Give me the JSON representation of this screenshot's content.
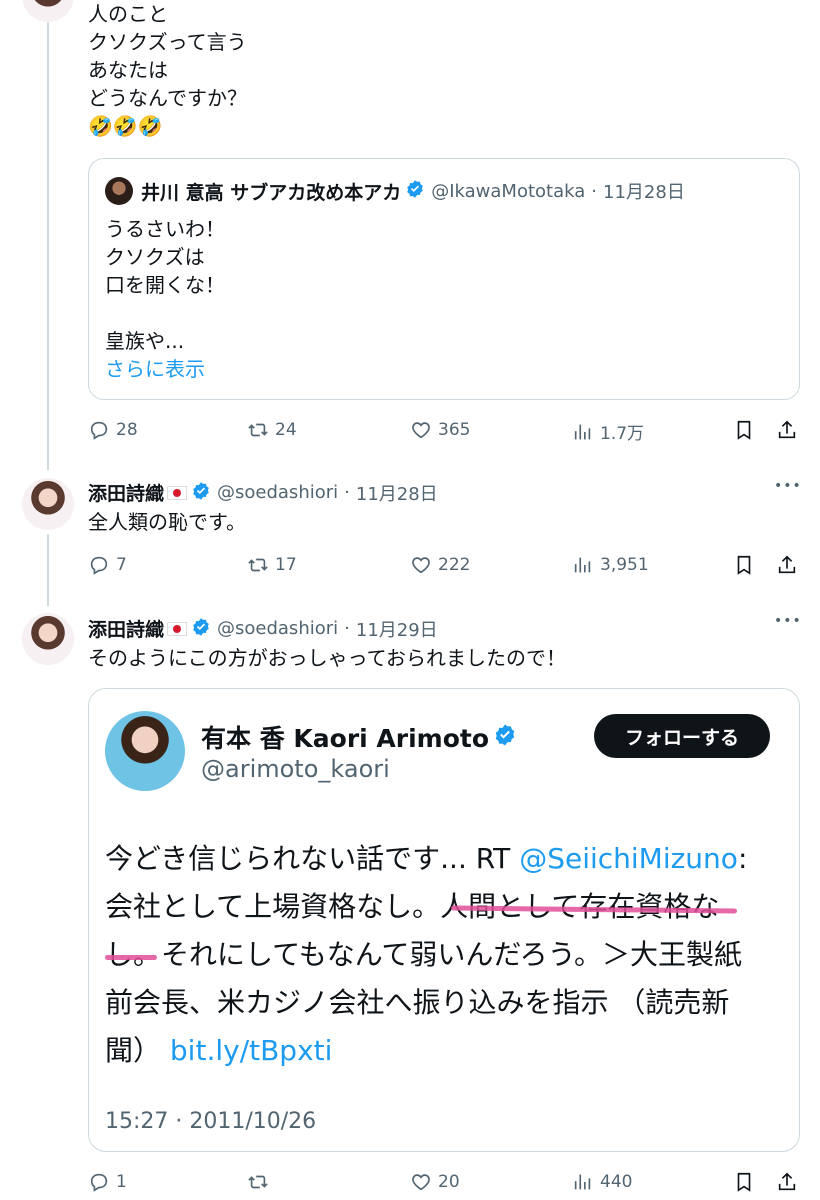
{
  "tweet1": {
    "lines": [
      "人のこと",
      "クソクズって言う",
      "あなたは",
      "どうなんですか？"
    ],
    "emoji": "🤣🤣🤣",
    "quote": {
      "name": "井川 意高 サブアカ改め本アカ",
      "handle": "@IkawaMototaka",
      "sep": "·",
      "date": "11月28日",
      "lines": [
        "うるさいわ！",
        "クソクズは",
        "口を開くな！",
        "",
        "皇族や..."
      ],
      "show_more": "さらに表示"
    },
    "actions": {
      "replies": "28",
      "reposts": "24",
      "likes": "365",
      "views": "1.7万"
    }
  },
  "tweet2": {
    "name": "添田詩織",
    "handle": "@soedashiori",
    "sep": "·",
    "date": "11月28日",
    "text": "全人類の恥です。",
    "actions": {
      "replies": "7",
      "reposts": "17",
      "likes": "222",
      "views": "3,951"
    },
    "more": "•••"
  },
  "tweet3": {
    "name": "添田詩織",
    "handle": "@soedashiori",
    "sep": "·",
    "date": "11月29日",
    "text": "そのようにこの方がおっしゃっておられましたので！",
    "more": "•••",
    "embed": {
      "name": "有本 香 Kaori Arimoto",
      "handle": "@arimoto_kaori",
      "follow": "フォローする",
      "line1_a": "今どき信じられない話です... RT ",
      "line1_mention": "@SeiichiMizuno",
      "line1_b": ":",
      "line2": "会社として上場資格なし。人間として存在資格な",
      "line3": "し。それにしてもなんて弱いんだろう。＞大王製紙",
      "line4": "前会長、米カジノ会社へ振り込みを指示 （読売新",
      "line5_a": "聞） ",
      "line5_link": "bit.ly/tBpxti",
      "timestamp": "15:27 · 2011/10/26"
    },
    "actions": {
      "replies": "1",
      "reposts": "",
      "likes": "20",
      "views": "440"
    }
  },
  "colors": {
    "link": "#1d9bf0",
    "muted": "#536471",
    "highlight": "#e14d9a",
    "verified": "#1d9bf0"
  }
}
